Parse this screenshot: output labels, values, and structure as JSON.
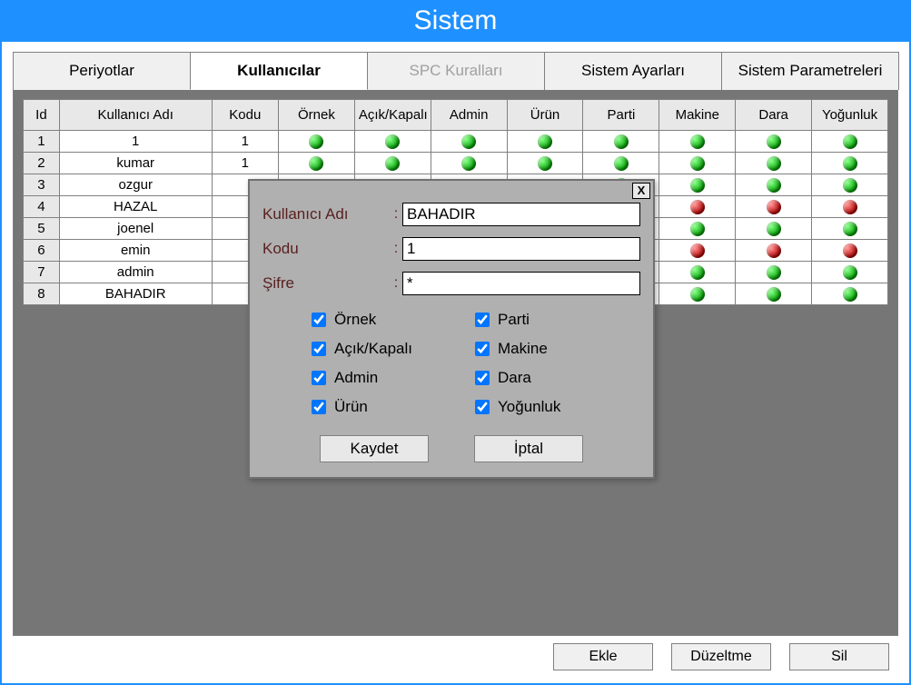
{
  "title": "Sistem",
  "tabs": [
    {
      "label": "Periyotlar",
      "active": false,
      "disabled": false
    },
    {
      "label": "Kullanıcılar",
      "active": true,
      "disabled": false
    },
    {
      "label": "SPC Kuralları",
      "active": false,
      "disabled": true
    },
    {
      "label": "Sistem Ayarları",
      "active": false,
      "disabled": false
    },
    {
      "label": "Sistem Parametreleri",
      "active": false,
      "disabled": false
    }
  ],
  "columns": [
    "Id",
    "Kullanıcı Adı",
    "Kodu",
    "Örnek",
    "Açık/Kapalı",
    "Admin",
    "Ürün",
    "Parti",
    "Makine",
    "Dara",
    "Yoğunluk"
  ],
  "rows": [
    {
      "id": "1",
      "name": "1",
      "kodu": "1",
      "flags": [
        "green",
        "green",
        "green",
        "green",
        "green",
        "green",
        "green",
        "green"
      ]
    },
    {
      "id": "2",
      "name": "kumar",
      "kodu": "1",
      "flags": [
        "green",
        "green",
        "green",
        "green",
        "green",
        "green",
        "green",
        "green"
      ]
    },
    {
      "id": "3",
      "name": "ozgur",
      "kodu": "",
      "flags": [
        "",
        "",
        "",
        "",
        "green",
        "green",
        "green",
        "green"
      ]
    },
    {
      "id": "4",
      "name": "HAZAL",
      "kodu": "",
      "flags": [
        "",
        "",
        "",
        "",
        "red",
        "red",
        "red",
        "red"
      ]
    },
    {
      "id": "5",
      "name": "joenel",
      "kodu": "",
      "flags": [
        "",
        "",
        "",
        "",
        "green",
        "green",
        "green",
        "green"
      ]
    },
    {
      "id": "6",
      "name": "emin",
      "kodu": "",
      "flags": [
        "",
        "",
        "",
        "",
        "red",
        "red",
        "red",
        "red"
      ]
    },
    {
      "id": "7",
      "name": "admin",
      "kodu": "",
      "flags": [
        "",
        "",
        "",
        "",
        "green",
        "green",
        "green",
        "green"
      ]
    },
    {
      "id": "8",
      "name": "BAHADIR",
      "kodu": "",
      "flags": [
        "",
        "",
        "",
        "",
        "green",
        "green",
        "green",
        "green"
      ]
    }
  ],
  "footer": {
    "add": "Ekle",
    "edit": "Düzeltme",
    "del": "Sil"
  },
  "dialog": {
    "close": "X",
    "fields": {
      "username_label": "Kullanıcı Adı",
      "username_value": "BAHADIR",
      "kodu_label": "Kodu",
      "kodu_value": "1",
      "sifre_label": "Şifre",
      "sifre_value": "*"
    },
    "checks": {
      "ornek": "Örnek",
      "acik": "Açık/Kapalı",
      "admin": "Admin",
      "urun": "Ürün",
      "parti": "Parti",
      "makine": "Makine",
      "dara": "Dara",
      "yogun": "Yoğunluk"
    },
    "save": "Kaydet",
    "cancel": "İptal"
  }
}
